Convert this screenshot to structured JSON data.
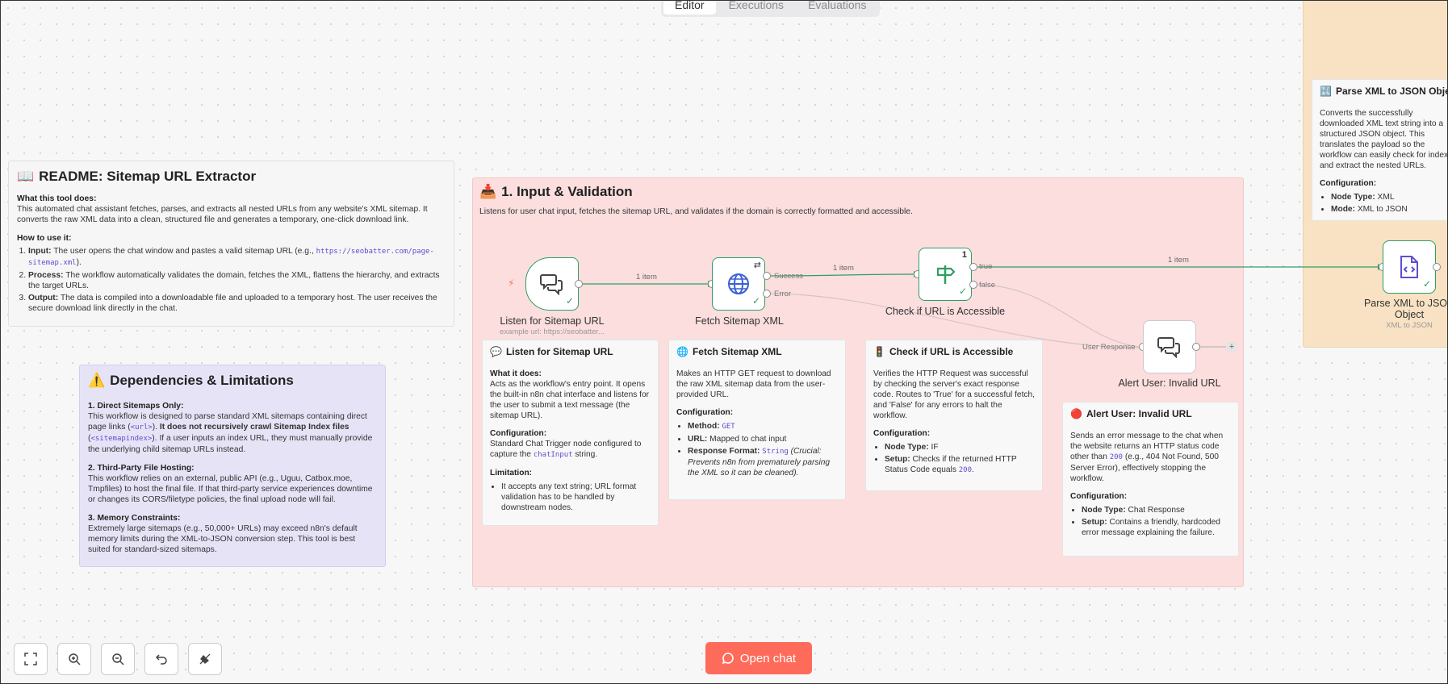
{
  "tabs": [
    {
      "label": "Editor",
      "active": true
    },
    {
      "label": "Executions",
      "active": false
    },
    {
      "label": "Evaluations",
      "active": false
    }
  ],
  "readme": {
    "emoji": "📖",
    "title": "README: Sitemap URL Extractor",
    "what_heading": "What this tool does:",
    "what_text": "This automated chat assistant fetches, parses, and extracts all nested URLs from any website's XML sitemap. It converts the raw XML data into a clean, structured file and generates a temporary, one-click download link.",
    "how_heading": "How to use it:",
    "steps": [
      {
        "label": "Input:",
        "text_before": " The user opens the chat window and pastes a valid sitemap URL (e.g., ",
        "code": "https://seobatter.com/page-sitemap.xml",
        "text_after": ")."
      },
      {
        "label": "Process:",
        "text_before": " The workflow automatically validates the domain, fetches the XML, flattens the hierarchy, and extracts the target URLs.",
        "code": "",
        "text_after": ""
      },
      {
        "label": "Output:",
        "text_before": " The data is compiled into a downloadable file and uploaded to a temporary host. The user receives the secure download link directly in the chat.",
        "code": "",
        "text_after": ""
      }
    ]
  },
  "deps": {
    "emoji": "⚠️",
    "title": "Dependencies & Limitations",
    "s1_heading": "1. Direct Sitemaps Only:",
    "s1_a": "This workflow is designed to parse standard XML sitemaps containing direct page links (",
    "s1_code1": "<url>",
    "s1_b": "). ",
    "s1_bold": "It does not recursively crawl Sitemap Index files",
    "s1_c": " (",
    "s1_code2": "<sitemapindex>",
    "s1_d": "). If a user inputs an index URL, they must manually provide the underlying child sitemap URLs instead.",
    "s2_heading": "2. Third-Party File Hosting:",
    "s2_text": "This workflow relies on an external, public API (e.g., Uguu, Catbox.moe, Tmpfiles) to host the final file. If that third-party service experiences downtime or changes its CORS/filetype policies, the final upload node will fail.",
    "s3_heading": "3. Memory Constraints:",
    "s3_text": "Extremely large sitemaps (e.g., 50,000+ URLs) may exceed n8n's default memory limits during the XML-to-JSON conversion step. This tool is best suited for standard-sized sitemaps."
  },
  "section1": {
    "emoji": "📥",
    "title": "1. Input & Validation",
    "desc": "Listens for user chat input, fetches the sitemap URL, and validates if the domain is correctly formatted and accessible."
  },
  "nodes": {
    "listen": {
      "label": "Listen for Sitemap URL",
      "sub": "example url: https://seobatter..."
    },
    "fetch": {
      "label": "Fetch Sitemap XML"
    },
    "check": {
      "label": "Check if URL is Accessible",
      "badge": "1"
    },
    "alert": {
      "label": "Alert User: Invalid URL"
    },
    "parse": {
      "label": "Parse XML to JSON Object",
      "sub": "XML to JSON"
    }
  },
  "ports": {
    "success": "Success",
    "error": "Error",
    "true": "true",
    "false": "false",
    "user_response": "User Response"
  },
  "edges": {
    "e1": "1 item",
    "e2": "1 item",
    "e3": "1 item"
  },
  "cards": {
    "listen": {
      "emoji": "💬",
      "title": "Listen for Sitemap URL",
      "what_heading": "What it does:",
      "what_text": "Acts as the workflow's entry point. It opens the built-in n8n chat interface and listens for the user to submit a text message (the sitemap URL).",
      "config_heading": "Configuration:",
      "config_before": "Standard Chat Trigger node configured to capture the ",
      "config_code": "chatInput",
      "config_after": " string.",
      "limit_heading": "Limitation:",
      "limit_item": "It accepts any text string; URL format validation has to be handled by downstream nodes."
    },
    "fetch": {
      "emoji": "🌐",
      "title": "Fetch Sitemap XML",
      "desc": "Makes an HTTP GET request to download the raw XML sitemap data from the user-provided URL.",
      "config_heading": "Configuration:",
      "method_label": "Method:",
      "method_code": "GET",
      "url_label": "URL:",
      "url_text": " Mapped to chat input",
      "format_label": "Response Format:",
      "format_code": "String",
      "format_note": "(Crucial: Prevents n8n from prematurely parsing the XML so it can be cleaned)."
    },
    "check": {
      "emoji": "🚦",
      "title": "Check if URL is Accessible",
      "desc": "Verifies the HTTP Request was successful by checking the server's exact response code. Routes to 'True' for a successful fetch, and 'False' for any errors to halt the workflow.",
      "config_heading": "Configuration:",
      "type_label": "Node Type:",
      "type_text": " IF",
      "setup_label": "Setup:",
      "setup_text": " Checks if the returned HTTP Status Code equals ",
      "setup_code": "200",
      "setup_end": "."
    },
    "alert": {
      "emoji": "🔴",
      "title": "Alert User: Invalid URL",
      "desc_before": "Sends an error message to the chat when the website returns an HTTP status code other than ",
      "desc_code": "200",
      "desc_after": " (e.g., 404 Not Found, 500 Server Error), effectively stopping the workflow.",
      "config_heading": "Configuration:",
      "type_label": "Node Type:",
      "type_text": " Chat Response",
      "setup_label": "Setup:",
      "setup_text": " Contains a friendly, hardcoded error message explaining the failure."
    },
    "parse": {
      "emoji": "🔣",
      "title": "Parse XML to JSON Object",
      "desc": "Converts the successfully downloaded XML text string into a structured JSON object. This translates the payload so the workflow can easily check for indexes and extract the nested URLs.",
      "config_heading": "Configuration:",
      "type_label": "Node Type:",
      "type_text": " XML",
      "mode_label": "Mode:",
      "mode_text": " XML to JSON"
    }
  },
  "toolbar": {
    "fit": "fit-view-icon",
    "zoom_in": "zoom-in-icon",
    "zoom_out": "zoom-out-icon",
    "undo": "reset-zoom-icon",
    "tidy": "tidy-up-icon"
  },
  "open_chat": {
    "label": "Open chat"
  },
  "colors": {
    "accent": "#ff6b5a",
    "node_border": "#2f9e65",
    "sticky_pink": "#fcdede",
    "sticky_orange": "#f8e2c3",
    "sticky_purple": "#e7e3f7"
  }
}
